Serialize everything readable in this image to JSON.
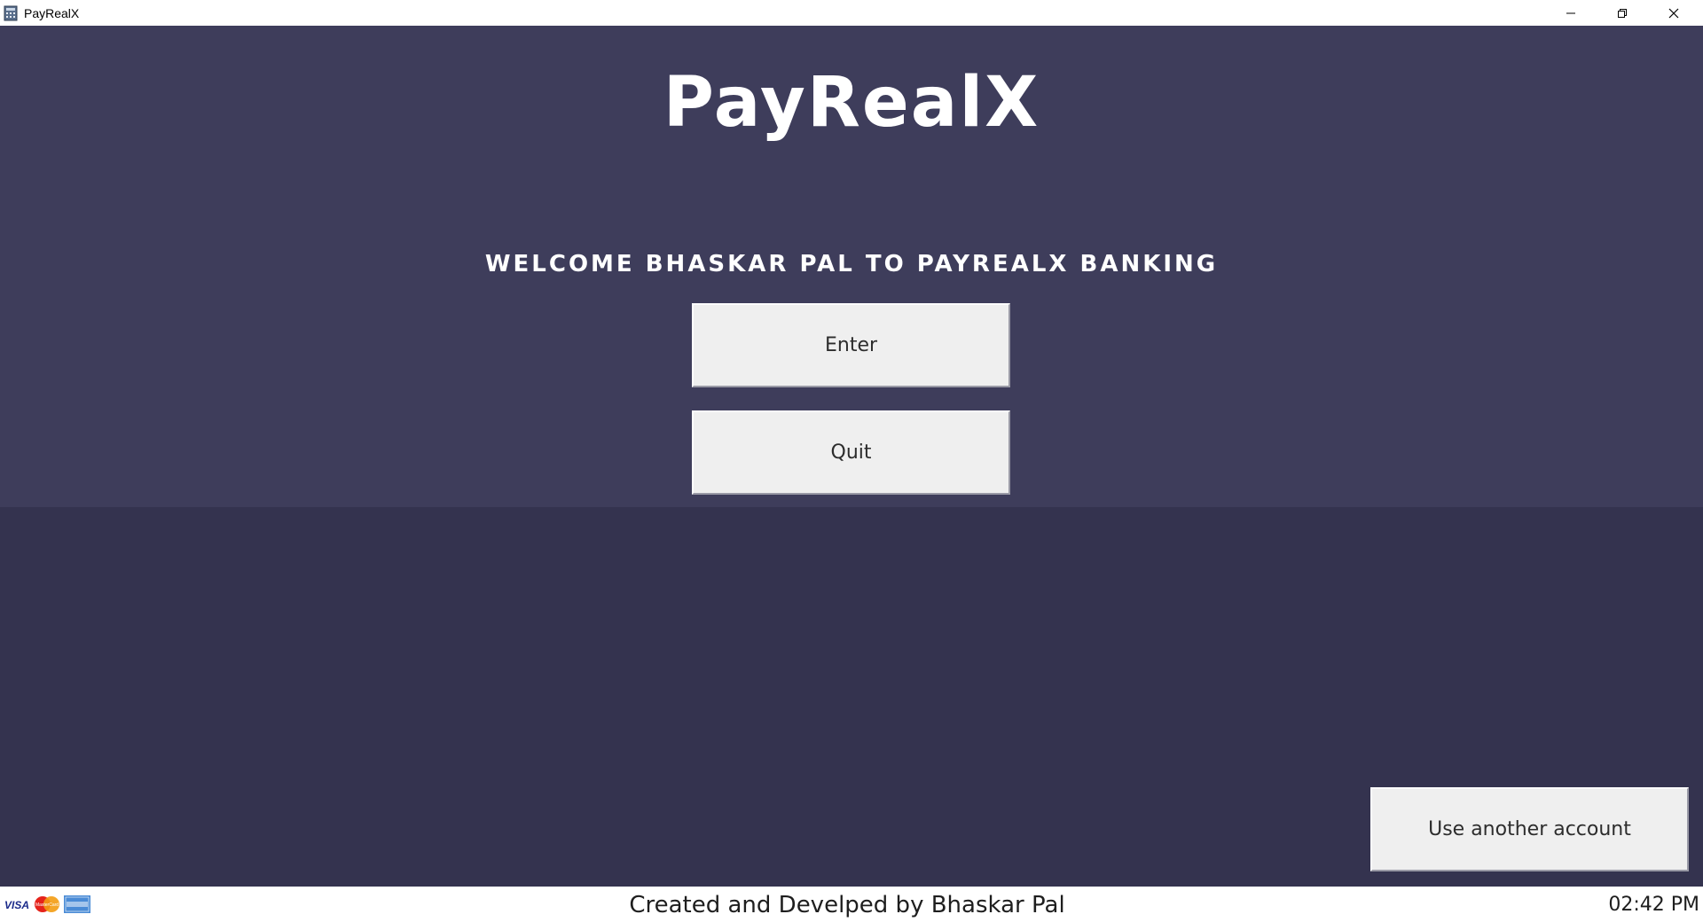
{
  "window": {
    "title": "PayRealX"
  },
  "header": {
    "logo": "PayRealX",
    "welcome": "WELCOME BHASKAR PAL TO PAYREALX BANKING"
  },
  "actions": {
    "enter_label": "Enter",
    "quit_label": "Quit",
    "another_account_label": "Use another account"
  },
  "footer": {
    "credit": "Created and Develped by Bhaskar Pal",
    "time": "02:42 PM",
    "card_logos": [
      "VISA",
      "MasterCard",
      "American Express"
    ]
  },
  "colors": {
    "top_panel": "#3e3d5b",
    "bottom_panel": "#34334f",
    "button_face": "#efefef"
  }
}
